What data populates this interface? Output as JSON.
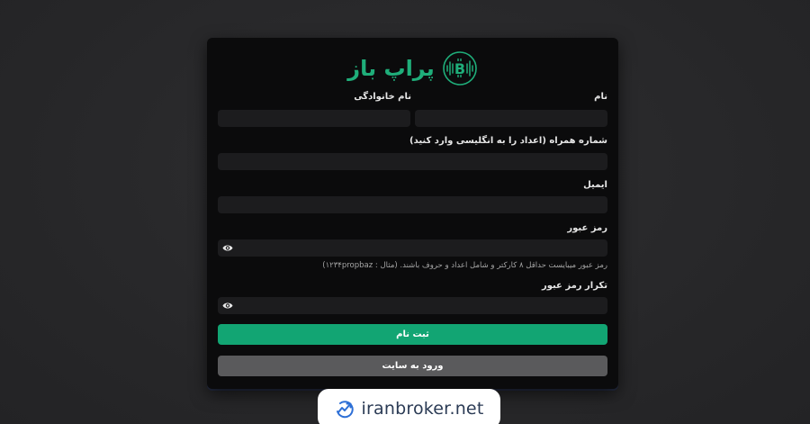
{
  "brand": {
    "name": "پراپ باز",
    "accent_color": "#1fae7a"
  },
  "form": {
    "first_name": {
      "label": "نام",
      "value": ""
    },
    "last_name": {
      "label": "نام خانوادگی",
      "value": ""
    },
    "mobile": {
      "label": "شماره همراه (اعداد را به انگلیسی وارد کنید)",
      "value": ""
    },
    "email": {
      "label": "ایمیل",
      "value": ""
    },
    "password": {
      "label": "رمز عبور",
      "value": "",
      "hint": "رمز عبور میبایست حداقل ۸ کارکتر و شامل اعداد و حروف باشند. (مثال : ۱۲۳۴propbaz)",
      "toggle_icon": "eye-icon"
    },
    "password_confirm": {
      "label": "تکرار رمز عبور",
      "value": "",
      "toggle_icon": "eye-icon"
    },
    "submit_label": "ثبت نام",
    "login_label": "ورود به سایت"
  },
  "watermark": {
    "text": "iranbroker.net",
    "icon": "chart-trend-icon"
  }
}
